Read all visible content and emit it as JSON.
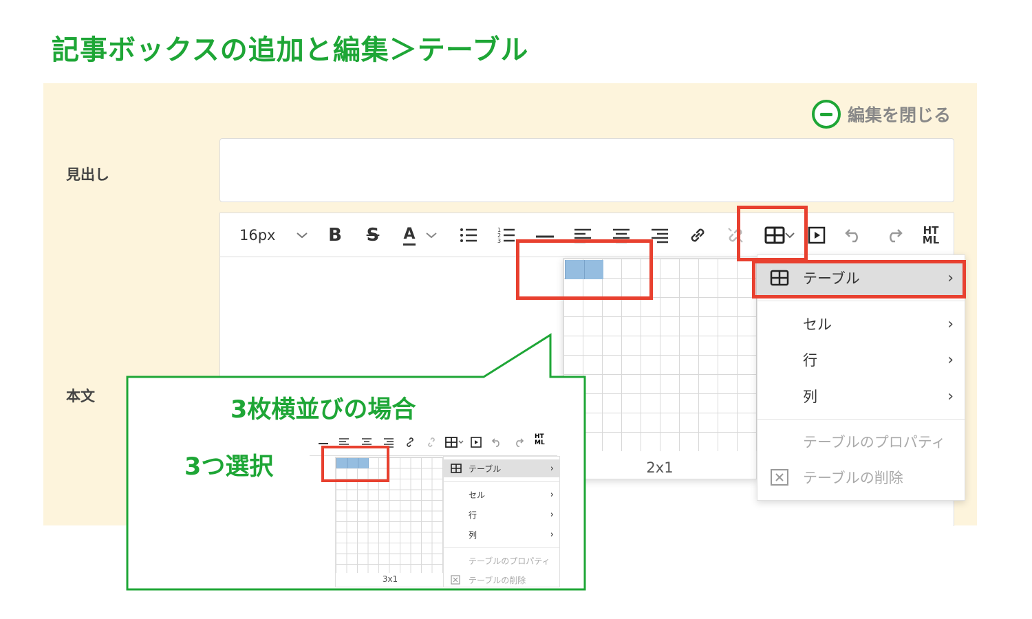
{
  "page_title": "記事ボックスの追加と編集＞テーブル",
  "close_edit_label": "編集を閉じる",
  "labels": {
    "heading": "見出し",
    "body": "本文"
  },
  "toolbar": {
    "font_size": "16px",
    "icons": [
      "bold-icon",
      "strikethrough-icon",
      "font-color-icon",
      "bullet-list-icon",
      "numbered-list-icon",
      "horizontal-rule-icon",
      "align-left-icon",
      "align-center-icon",
      "align-right-icon",
      "link-icon",
      "unlink-icon",
      "table-icon",
      "media-icon",
      "undo-icon",
      "redo-icon",
      "html-icon"
    ],
    "html_label_top": "HT",
    "html_label_bottom": "ML"
  },
  "table_grid": {
    "size_label": "2x1",
    "selected_cols": 2,
    "selected_rows": 1
  },
  "table_menu": {
    "items": [
      {
        "label": "テーブル",
        "has_submenu": true,
        "active": true
      },
      {
        "label": "セル",
        "has_submenu": true
      },
      {
        "label": "行",
        "has_submenu": true
      },
      {
        "label": "列",
        "has_submenu": true
      },
      {
        "label": "テーブルのプロパティ",
        "disabled": true
      },
      {
        "label": "テーブルの削除",
        "disabled": true
      }
    ]
  },
  "callout": {
    "title": "3枚横並びの場合",
    "instruction": "3つ選択",
    "mini_grid_size": "3x1",
    "mini_selected_cols": 3
  },
  "colors": {
    "accent_green": "#1ea636",
    "highlight_red": "#e8402f",
    "panel_bg": "#fdf4dc",
    "cell_selected": "#95bde0"
  }
}
